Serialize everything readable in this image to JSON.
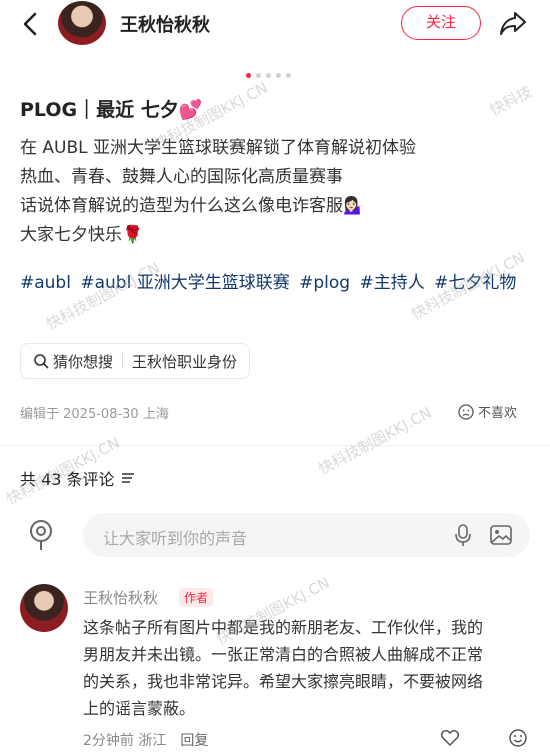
{
  "header": {
    "author_name": "王秋怡秋秋",
    "follow_label": "关注"
  },
  "carousel": {
    "dot_count": 5,
    "active_index": 0
  },
  "post": {
    "title": "PLOG｜最近 七夕💕",
    "lines": [
      "在 AUBL 亚洲大学生篮球联赛解锁了体育解说初体验",
      "热血、青春、鼓舞人心的国际化高质量赛事",
      "话说体育解说的造型为什么这么像电诈客服💁🏻‍♀️",
      "大家七夕快乐🌹"
    ],
    "tags": [
      "#aubl",
      "#aubl 亚洲大学生篮球联赛",
      "#plog",
      "#主持人",
      "#七夕礼物"
    ]
  },
  "search_chip": {
    "label": "猜你想搜",
    "query": "王秋怡职业身份"
  },
  "meta": {
    "edited": "编辑于 2025-08-30 上海",
    "dislike_label": "不喜欢"
  },
  "comments_section": {
    "count_label": "共 43 条评论",
    "input_placeholder": "让大家听到你的声音"
  },
  "comment": {
    "name": "王秋怡秋秋",
    "badge": "作者",
    "lines": [
      "这条帖子所有图片中都是我的新朋老友、工作伙伴，我的",
      "男朋友并未出镜。一张正常清白的合照被人曲解成不正常",
      "的关系，我也非常诧异。希望大家擦亮眼睛，不要被网络",
      "上的谣言蒙蔽。"
    ],
    "time": "2分钟前 浙江",
    "reply_label": "回复"
  },
  "watermark": {
    "text_a": "快科技制图KKJ.CN",
    "text_b": "快科技"
  },
  "colors": {
    "accent": "#ff2442",
    "tag": "#13386c"
  }
}
